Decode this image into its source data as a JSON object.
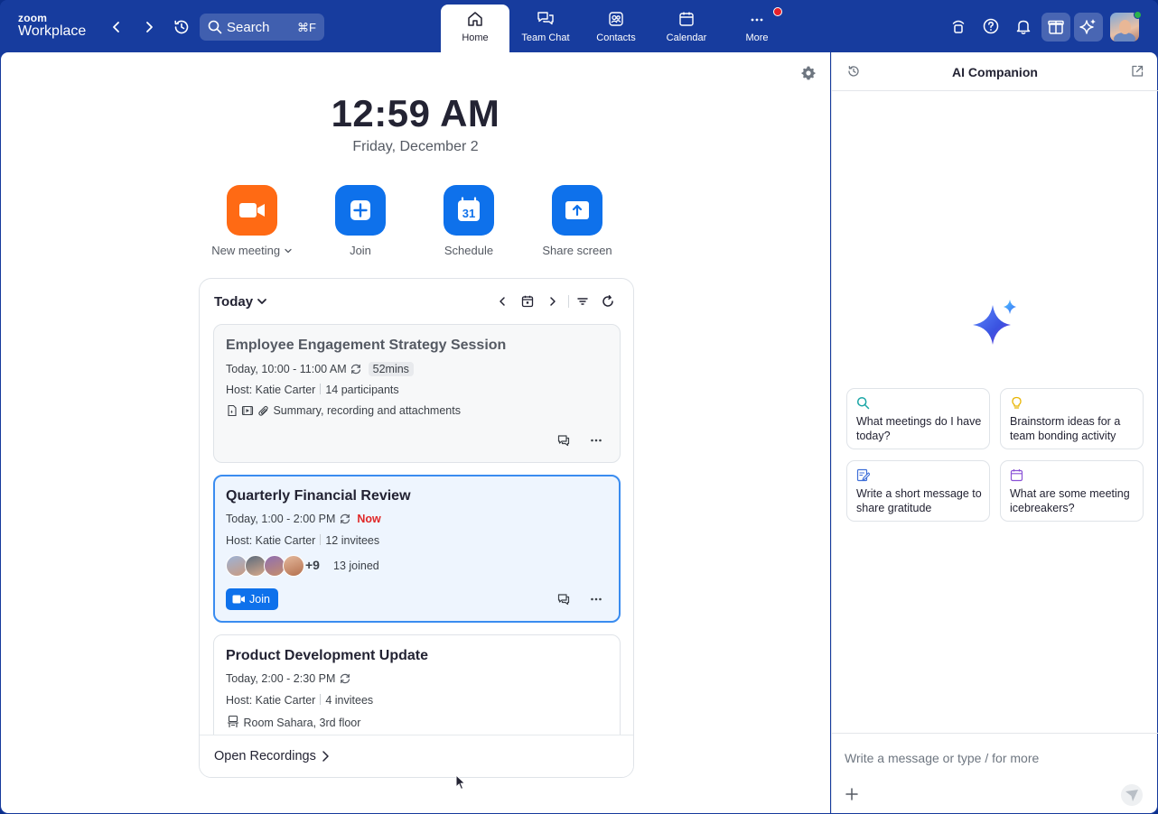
{
  "app": {
    "logo_top": "zoom",
    "logo_bottom": "Workplace"
  },
  "topbar": {
    "search_label": "Search",
    "search_shortcut": "⌘F",
    "tabs": [
      {
        "label": "Home",
        "icon": "home-icon",
        "active": true
      },
      {
        "label": "Team Chat",
        "icon": "chat-icon"
      },
      {
        "label": "Contacts",
        "icon": "contacts-icon"
      },
      {
        "label": "Calendar",
        "icon": "calendar-icon"
      },
      {
        "label": "More",
        "icon": "more-icon",
        "has_notification": true
      }
    ]
  },
  "home": {
    "time": "12:59 AM",
    "date": "Friday, December 2",
    "actions": [
      {
        "label": "New meeting",
        "icon": "video-camera-icon",
        "color": "#ff6a14"
      },
      {
        "label": "Join",
        "icon": "plus-icon",
        "color": "#0e71eb"
      },
      {
        "label": "Schedule",
        "icon": "calendar-31-icon",
        "color": "#0e71eb"
      },
      {
        "label": "Share screen",
        "icon": "share-screen-icon",
        "color": "#0e71eb"
      }
    ],
    "schedule_icon_day": "31"
  },
  "meetings_card": {
    "period": "Today",
    "footer": "Open Recordings",
    "meetings": [
      {
        "title": "Employee Engagement Strategy Session",
        "time": "Today, 10:00 - 11:00 AM",
        "duration": "52mins",
        "host": "Host: Katie Carter",
        "people": "14 participants",
        "extra": "Summary, recording and attachments"
      },
      {
        "title": "Quarterly Financial Review",
        "time": "Today, 1:00 - 2:00 PM",
        "status": "Now",
        "host": "Host: Katie Carter",
        "people": "12 invitees",
        "more_count": "+9",
        "joined": "13 joined",
        "join_label": "Join"
      },
      {
        "title": "Product Development Update",
        "time": "Today, 2:00 - 2:30 PM",
        "host": "Host: Katie Carter",
        "people": "4 invitees",
        "room": "Room Sahara, 3rd floor"
      }
    ]
  },
  "ai_panel": {
    "title": "AI Companion",
    "suggestions": [
      {
        "text": "What meetings do I have today?",
        "icon": "search-icon",
        "color": "#1aa6a6"
      },
      {
        "text": "Brainstorm ideas for a team bonding activity",
        "icon": "lightbulb-icon",
        "color": "#e8b400"
      },
      {
        "text": "Write a short message to share gratitude",
        "icon": "compose-icon",
        "color": "#3f6fd8"
      },
      {
        "text": "What are some meeting icebreakers?",
        "icon": "calendar-icon",
        "color": "#8a52d6"
      }
    ],
    "composer_placeholder": "Write a message or type / for more"
  }
}
